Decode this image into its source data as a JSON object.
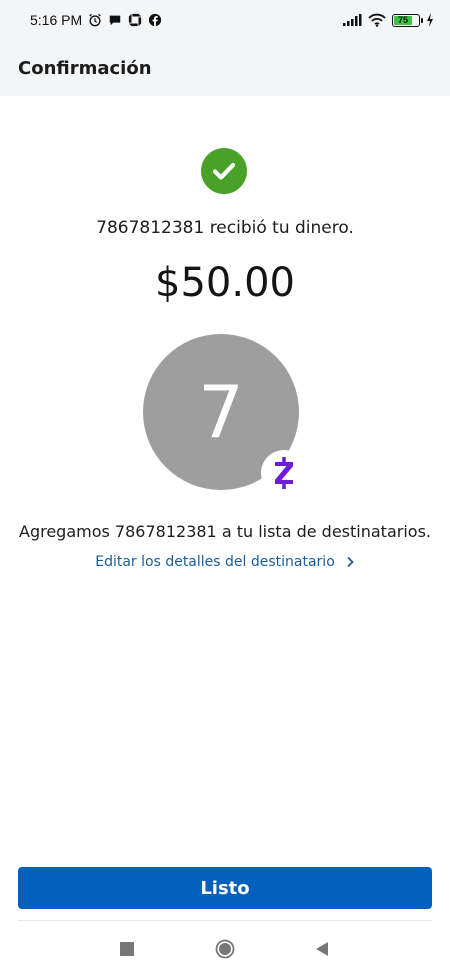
{
  "status_bar": {
    "time": "5:16 PM",
    "battery_level": "75",
    "icons": [
      "alarm-icon",
      "chat-icon",
      "chase-icon",
      "facebook-icon",
      "signal-icon",
      "wifi-icon",
      "battery-icon",
      "charging-icon"
    ]
  },
  "header": {
    "title": "Confirmación"
  },
  "confirmation": {
    "received_message": "7867812381 recibió tu dinero.",
    "amount": "$50.00",
    "avatar_initial": "7",
    "added_message": "Agregamos 7867812381 a tu lista de destinatarios.",
    "edit_link": "Editar los detalles del destinatario"
  },
  "footer": {
    "done_label": "Listo"
  },
  "colors": {
    "success": "#4aa128",
    "primary_button": "#0560bd",
    "link": "#1a5f9a",
    "avatar_bg": "#9e9e9e",
    "zelle_purple": "#6d1ed4"
  }
}
